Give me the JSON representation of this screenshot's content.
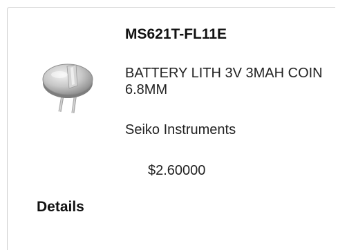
{
  "product": {
    "part_number": "MS621T-FL11E",
    "description": "BATTERY LITH 3V 3MAH COIN 6.8MM",
    "manufacturer": "Seiko Instruments",
    "price": "$2.60000",
    "image_icon": "coin-cell-battery-icon"
  },
  "actions": {
    "details_label": "Details"
  }
}
